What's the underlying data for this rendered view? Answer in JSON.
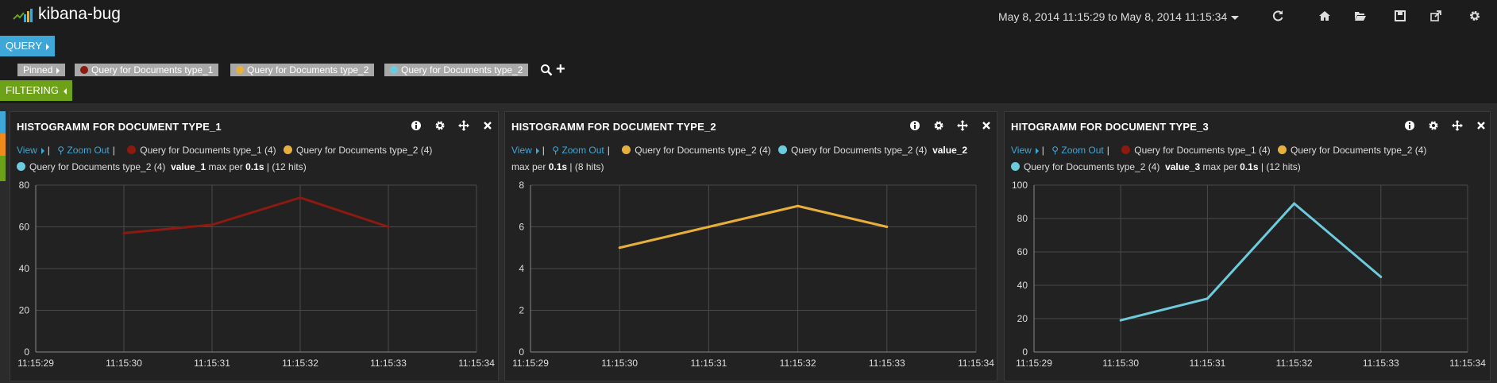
{
  "app": {
    "title": "kibana-bug"
  },
  "header": {
    "timerange": "May 8, 2014 11:15:29 to May 8, 2014 11:15:34",
    "icons": [
      "refresh-icon",
      "home-icon",
      "folder-open-icon",
      "save-icon",
      "share-icon",
      "gear-icon"
    ]
  },
  "query_bar": {
    "label": "QUERY",
    "pinned_label": "Pinned",
    "queries": [
      {
        "label": "Query for Documents type_1",
        "color": "#8b1a10"
      },
      {
        "label": "Query for Documents type_2",
        "color": "#e8b03a"
      },
      {
        "label": "Query for Documents type_2",
        "color": "#6ccbdc"
      }
    ]
  },
  "filter_bar": {
    "label": "FILTERING"
  },
  "side_colors": [
    "#3fa7d8",
    "#ef8b1b",
    "#6da117"
  ],
  "panels": [
    {
      "title": "HISTOGRAMM FOR DOCUMENT TYPE_1",
      "view_label": "View",
      "zoom_out_label": "Zoom Out",
      "legend": [
        {
          "label": "Query for Documents type_1 (4)",
          "color": "#8b1a10"
        },
        {
          "label": "Query for Documents type_2 (4)",
          "color": "#e8b03a"
        },
        {
          "label": "Query for Documents type_2 (4)",
          "color": "#6ccbdc"
        }
      ],
      "value_name": "value_1",
      "stat_text_1": "max per",
      "interval": "0.1s",
      "hits": "(12 hits)"
    },
    {
      "title": "HISTOGRAMM FOR DOCUMENT TYPE_2",
      "view_label": "View",
      "zoom_out_label": "Zoom Out",
      "legend": [
        {
          "label": "Query for Documents type_2 (4)",
          "color": "#e8b03a"
        },
        {
          "label": "Query for Documents type_2 (4)",
          "color": "#6ccbdc"
        }
      ],
      "value_name": "value_2",
      "stat_text_1": "max per",
      "interval": "0.1s",
      "hits": "(8 hits)"
    },
    {
      "title": "HITOGRAMM FOR DOCUMENT TYPE_3",
      "view_label": "View",
      "zoom_out_label": "Zoom Out",
      "legend": [
        {
          "label": "Query for Documents type_1 (4)",
          "color": "#8b1a10"
        },
        {
          "label": "Query for Documents type_2 (4)",
          "color": "#e8b03a"
        },
        {
          "label": "Query for Documents type_2 (4)",
          "color": "#6ccbdc"
        }
      ],
      "value_name": "value_3",
      "stat_text_1": "max per",
      "interval": "0.1s",
      "hits": "(12 hits)"
    }
  ],
  "chart_data": [
    {
      "type": "line",
      "x_ticks": [
        "11:15:29",
        "11:15:30",
        "11:15:31",
        "11:15:32",
        "11:15:33",
        "11:15:34"
      ],
      "y_ticks": [
        0,
        20,
        40,
        60,
        80
      ],
      "ylim": [
        0,
        80
      ],
      "grid": true,
      "series": [
        {
          "color": "#8b1a10",
          "x": [
            "11:15:30",
            "11:15:31",
            "11:15:32",
            "11:15:33"
          ],
          "values": [
            57,
            61,
            74,
            60
          ]
        }
      ]
    },
    {
      "type": "line",
      "x_ticks": [
        "11:15:29",
        "11:15:30",
        "11:15:31",
        "11:15:32",
        "11:15:33",
        "11:15:34"
      ],
      "y_ticks": [
        0,
        2,
        4,
        6,
        8
      ],
      "ylim": [
        0,
        8
      ],
      "grid": true,
      "series": [
        {
          "color": "#e8b03a",
          "x": [
            "11:15:30",
            "11:15:31",
            "11:15:32",
            "11:15:33"
          ],
          "values": [
            5,
            6,
            7,
            6
          ]
        }
      ]
    },
    {
      "type": "line",
      "x_ticks": [
        "11:15:29",
        "11:15:30",
        "11:15:31",
        "11:15:32",
        "11:15:33",
        "11:15:34"
      ],
      "y_ticks": [
        0,
        20,
        40,
        60,
        80,
        100
      ],
      "ylim": [
        0,
        100
      ],
      "grid": true,
      "series": [
        {
          "color": "#6ccbdc",
          "x": [
            "11:15:30",
            "11:15:31",
            "11:15:32",
            "11:15:33"
          ],
          "values": [
            19,
            32,
            89,
            45
          ]
        }
      ]
    }
  ]
}
